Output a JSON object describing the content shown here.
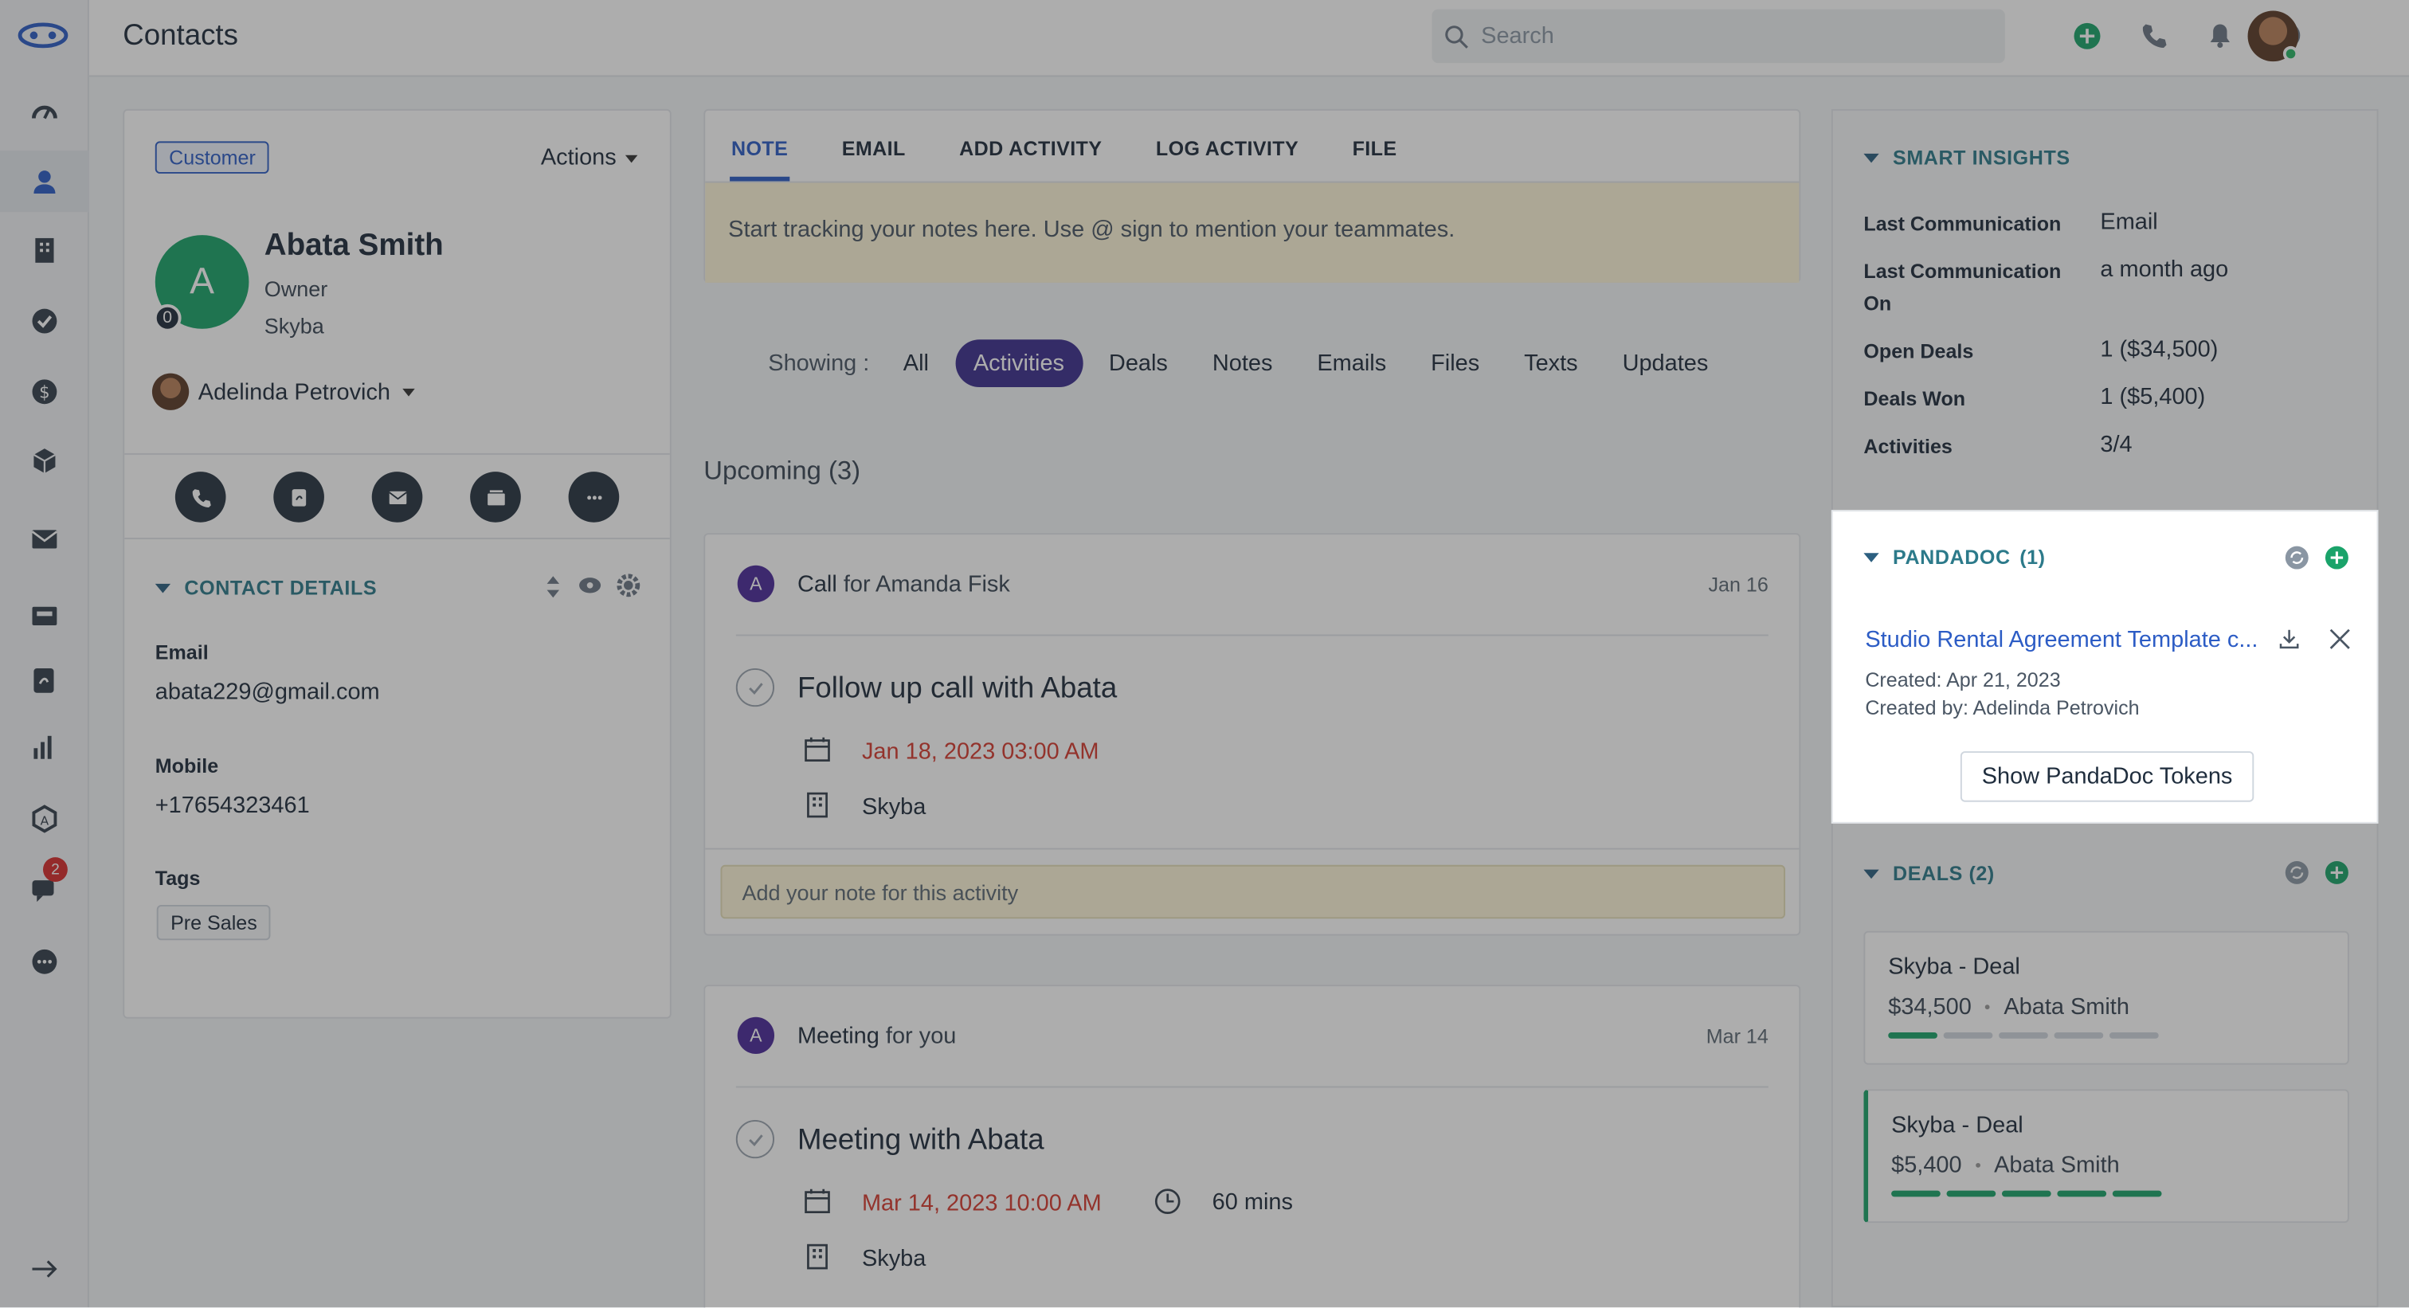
{
  "app": {
    "page_title": "Contacts",
    "search_placeholder": "Search",
    "chat_badge": "2"
  },
  "contact": {
    "badge": "Customer",
    "actions_label": "Actions",
    "avatar_letter": "A",
    "score": "0",
    "name": "Abata Smith",
    "role": "Owner",
    "company": "Skyba",
    "owner": "Adelinda Petrovich",
    "details_heading": "CONTACT DETAILS",
    "email_label": "Email",
    "email": "abata229@gmail.com",
    "mobile_label": "Mobile",
    "mobile": "+17654323461",
    "tags_label": "Tags",
    "tag": "Pre Sales"
  },
  "composer": {
    "tabs": [
      "NOTE",
      "EMAIL",
      "ADD ACTIVITY",
      "LOG ACTIVITY",
      "FILE"
    ],
    "placeholder": "Start tracking your notes here. Use @ sign to mention your teammates."
  },
  "filters": {
    "label": "Showing :",
    "items": [
      "All",
      "Activities",
      "Deals",
      "Notes",
      "Emails",
      "Files",
      "Texts",
      "Updates"
    ],
    "active": "Activities"
  },
  "upcoming": {
    "heading": "Upcoming (3)",
    "activities": [
      {
        "avatar": "A",
        "type": "Call",
        "for_text": "for Amanda Fisk",
        "date": "Jan 16",
        "title": "Follow up call with Abata",
        "due": "Jan 18, 2023 03:00 AM",
        "company": "Skyba",
        "note_placeholder": "Add your note for this activity"
      },
      {
        "avatar": "A",
        "type": "Meeting",
        "for_text": "for you",
        "date": "Mar 14",
        "title": "Meeting with Abata",
        "due": "Mar 14, 2023 10:00 AM",
        "duration": "60 mins",
        "company": "Skyba"
      }
    ]
  },
  "insights": {
    "heading": "SMART INSIGHTS",
    "rows": [
      {
        "label": "Last Communication",
        "value": "Email"
      },
      {
        "label": "Last Communication On",
        "value": "a month ago"
      },
      {
        "label": "Open Deals",
        "value": "1 ($34,500)"
      },
      {
        "label": "Deals Won",
        "value": "1 ($5,400)"
      },
      {
        "label": "Activities",
        "value": "3/4"
      }
    ]
  },
  "pandadoc": {
    "heading": "PANDADOC",
    "count": "(1)",
    "doc_title": "Studio Rental Agreement Template c...",
    "created": "Created: Apr 21, 2023",
    "created_by": "Created by: Adelinda Petrovich",
    "tokens_button": "Show PandaDoc Tokens"
  },
  "deals": {
    "heading": "DEALS (2)",
    "items": [
      {
        "name": "Skyba - Deal",
        "amount": "$34,500",
        "contact": "Abata Smith",
        "progress_stages_done": 1,
        "progress_stages_total": 5,
        "won": false
      },
      {
        "name": "Skyba - Deal",
        "amount": "$5,400",
        "contact": "Abata Smith",
        "progress_stages_done": 5,
        "progress_stages_total": 5,
        "won": true
      }
    ]
  },
  "colors": {
    "brand_blue": "#2c5cc5",
    "active_filter": "#3c2f8f",
    "avatar_green": "#1aa36a",
    "due_red": "#d63b2f",
    "note_yellow": "#fdf6d8"
  }
}
